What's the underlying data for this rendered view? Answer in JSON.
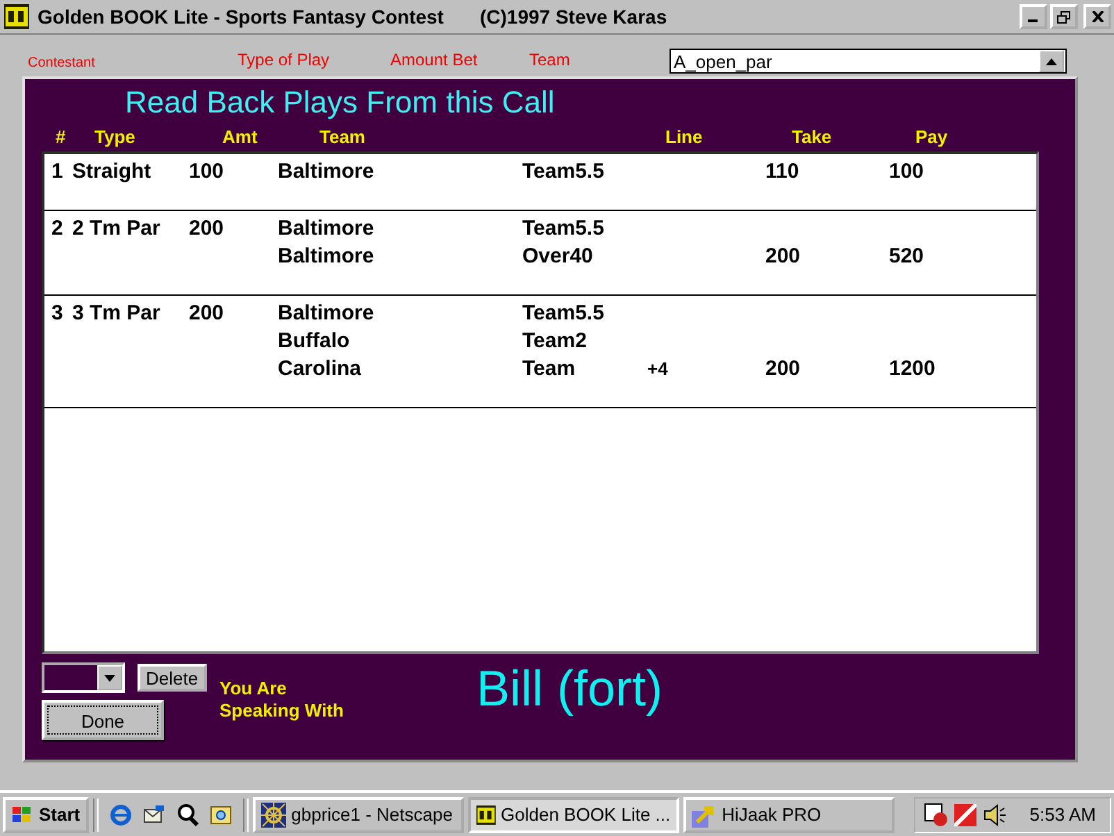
{
  "window": {
    "title": "Golden BOOK Lite - Sports  Fantasy Contest",
    "copyright": "(C)1997 Steve Karas"
  },
  "background_labels": [
    {
      "text": "Contestant"
    },
    {
      "text": "Type of Play"
    },
    {
      "text": "Amount Bet"
    },
    {
      "text": "Team"
    }
  ],
  "contest_combo": {
    "value": "A_open_par"
  },
  "dialog": {
    "title": "Read Back Plays From this Call",
    "columns": [
      "#",
      "Type",
      "Amt",
      "Team",
      "Line",
      "Take",
      "Pay"
    ],
    "plays": [
      {
        "number": "1",
        "type": "Straight",
        "amount": "100",
        "legs": [
          {
            "team": "Baltimore",
            "bet": "Team5.5",
            "take": "110",
            "pay": "100"
          }
        ]
      },
      {
        "number": "2",
        "type": "2 Tm Par",
        "amount": "200",
        "legs": [
          {
            "team": "Baltimore",
            "bet": "Team5.5"
          },
          {
            "team": "Baltimore",
            "bet": "Over40",
            "take": "200",
            "pay": "520"
          }
        ]
      },
      {
        "number": "3",
        "type": "3 Tm Par",
        "amount": "200",
        "legs": [
          {
            "team": "Baltimore",
            "bet": "Team5.5"
          },
          {
            "team": "Buffalo",
            "bet": "Team2"
          },
          {
            "team": "Carolina",
            "bet": "Team",
            "line": "+4",
            "take": "200",
            "pay": "1200"
          }
        ]
      }
    ],
    "delete_button": "Delete",
    "done_button": "Done",
    "speaking_label": [
      "You Are",
      "Speaking With"
    ],
    "caller": "Bill  (fort)"
  },
  "taskbar": {
    "start": "Start",
    "tasks": [
      {
        "label": "gbprice1 - Netscape",
        "kind": "netscape",
        "selected": false
      },
      {
        "label": "Golden BOOK Lite ...",
        "kind": "gb",
        "selected": true
      },
      {
        "label": "HiJaak PRO",
        "kind": "hijaak",
        "selected": false
      }
    ],
    "clock": "5:53 AM"
  }
}
